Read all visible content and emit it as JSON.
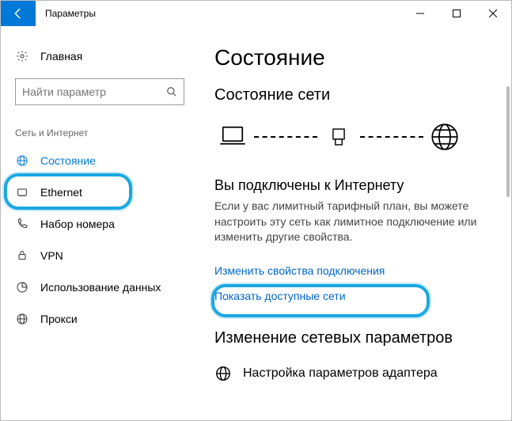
{
  "titlebar": {
    "app_title": "Параметры"
  },
  "sidebar": {
    "home_label": "Главная",
    "search_placeholder": "Найти параметр",
    "group_label": "Сеть и Интернет",
    "items": [
      {
        "label": "Состояние"
      },
      {
        "label": "Ethernet"
      },
      {
        "label": "Набор номера"
      },
      {
        "label": "VPN"
      },
      {
        "label": "Использование данных"
      },
      {
        "label": "Прокси"
      }
    ]
  },
  "main": {
    "page_title": "Состояние",
    "section_status": "Состояние сети",
    "connected_title": "Вы подключены к Интернету",
    "connected_desc": "Если у вас лимитный тарифный план, вы можете настроить эту сеть как лимитное подключение или изменить другие свойства.",
    "link_change_props": "Изменить свойства подключения",
    "link_show_networks": "Показать доступные сети",
    "section_params": "Изменение сетевых параметров",
    "adapter_row": "Настройка параметров адаптера"
  }
}
